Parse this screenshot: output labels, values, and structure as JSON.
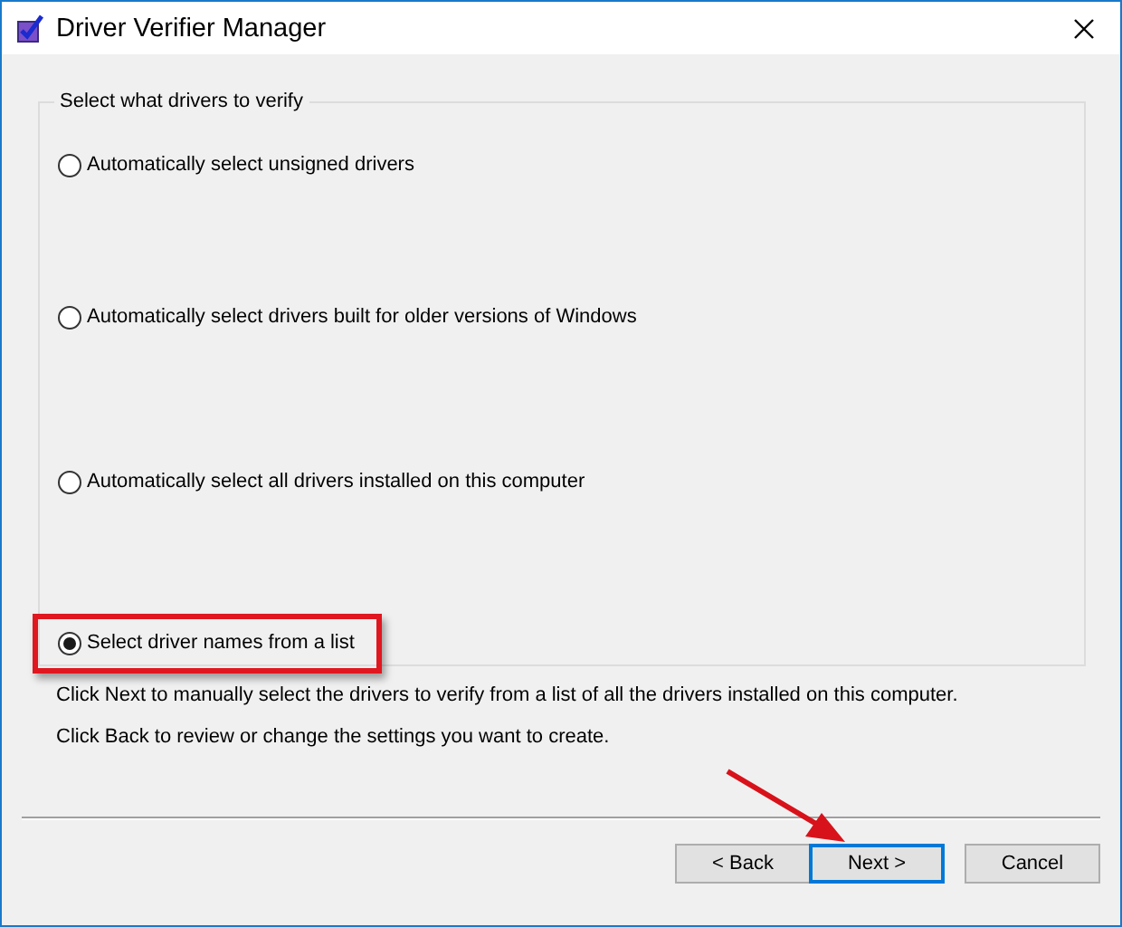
{
  "window": {
    "title": "Driver Verifier Manager"
  },
  "group": {
    "legend": "Select what drivers to verify",
    "options": [
      {
        "label": "Automatically select unsigned drivers",
        "selected": false,
        "highlighted": false
      },
      {
        "label": "Automatically select drivers built for older versions of Windows",
        "selected": false,
        "highlighted": false
      },
      {
        "label": "Automatically select all drivers installed on this computer",
        "selected": false,
        "highlighted": false
      },
      {
        "label": "Select driver names from a list",
        "selected": true,
        "highlighted": true
      }
    ]
  },
  "info": [
    "Click Next to manually select the drivers to verify from a list of all the drivers installed on this computer.",
    "Click Back to review or change the settings you want to create."
  ],
  "buttons": [
    {
      "label": "< Back",
      "focused": false
    },
    {
      "label": "Next >",
      "focused": true
    },
    {
      "label": "Cancel",
      "focused": false
    }
  ]
}
